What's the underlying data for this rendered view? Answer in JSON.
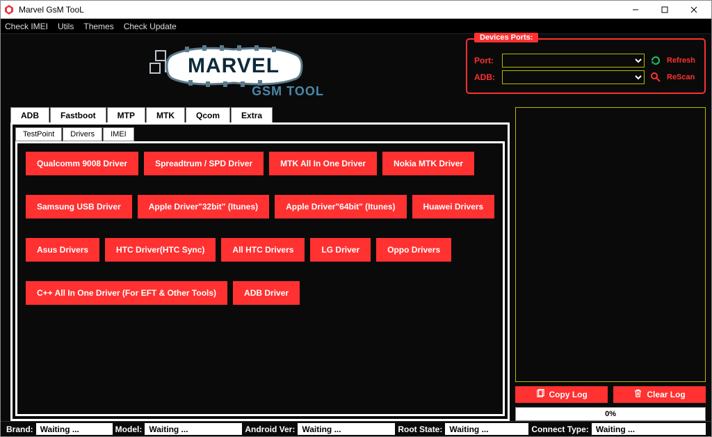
{
  "window": {
    "title": "Marvel GsM TooL"
  },
  "menu": {
    "items": [
      "Check IMEI",
      "Utils",
      "Themes",
      "Check Update"
    ]
  },
  "devices": {
    "legend": "Devices Ports:",
    "port_label": "Port:",
    "adb_label": "ADB:",
    "refresh_label": "Refresh",
    "rescan_label": "ReScan"
  },
  "main_tabs": [
    "ADB",
    "Fastboot",
    "MTP",
    "MTK",
    "Qcom",
    "Extra"
  ],
  "main_tab_active": 5,
  "sub_tabs": [
    "TestPoint",
    "Drivers",
    "IMEI"
  ],
  "sub_tab_active": 1,
  "drivers": {
    "rows": [
      [
        "Qualcomm 9008 Driver",
        "Spreadtrum / SPD Driver",
        "MTK All In One Driver",
        "Nokia MTK Driver"
      ],
      [
        "Samsung USB Driver",
        "Apple Driver\"32bit\" (Itunes)",
        "Apple Driver\"64bit\" (Itunes)",
        "Huawei Drivers"
      ],
      [
        "Asus Drivers",
        "HTC Driver(HTC Sync)",
        "All HTC Drivers",
        "LG Driver",
        "Oppo Drivers"
      ],
      [
        "C++ All In One Driver (For EFT & Other Tools)",
        "ADB Driver"
      ]
    ]
  },
  "log_actions": {
    "copy": "Copy Log",
    "clear": "Clear Log"
  },
  "progress": "0%",
  "status": {
    "brand_label": "Brand:",
    "brand_value": "Waiting ...",
    "model_label": "Model:",
    "model_value": "Waiting ...",
    "android_label": "Android Ver:",
    "android_value": "Waiting ...",
    "root_label": "Root State:",
    "root_value": "Waiting ...",
    "connect_label": "Connect Type:",
    "connect_value": "Waiting ..."
  },
  "logo": {
    "text1": "MARVEL",
    "text2": "GSM TOOL"
  }
}
